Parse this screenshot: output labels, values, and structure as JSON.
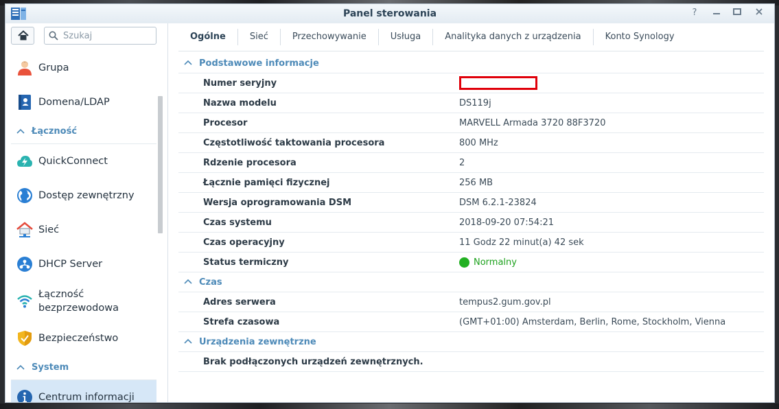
{
  "window": {
    "title": "Panel sterowania"
  },
  "sidebar": {
    "search_placeholder": "Szukaj",
    "items": [
      {
        "label": "Grupa",
        "icon": "group-icon"
      },
      {
        "label": "Domena/LDAP",
        "icon": "domain-ldap-icon"
      }
    ],
    "section_connectivity": "Łączność",
    "connectivity_items": [
      {
        "label": "QuickConnect",
        "icon": "quickconnect-icon"
      },
      {
        "label": "Dostęp zewnętrzny",
        "icon": "globe-icon"
      },
      {
        "label": "Sieć",
        "icon": "network-house-icon"
      },
      {
        "label": "DHCP Server",
        "icon": "dhcp-icon"
      },
      {
        "label": "Łączność bezprzewodowa",
        "icon": "wifi-icon"
      },
      {
        "label": "Bezpieczeństwo",
        "icon": "shield-icon"
      }
    ],
    "section_system": "System",
    "system_items": [
      {
        "label": "Centrum informacji",
        "icon": "info-icon",
        "active": true
      }
    ]
  },
  "tabs": [
    "Ogólne",
    "Sieć",
    "Przechowywanie",
    "Usługa",
    "Analityka danych z urządzenia",
    "Konto Synology"
  ],
  "sections": {
    "basic": {
      "title": "Podstawowe informacje",
      "rows": [
        {
          "key": "Numer seryjny",
          "value": ""
        },
        {
          "key": "Nazwa modelu",
          "value": "DS119j"
        },
        {
          "key": "Procesor",
          "value": "MARVELL Armada 3720 88F3720"
        },
        {
          "key": "Częstotliwość taktowania procesora",
          "value": "800 MHz"
        },
        {
          "key": "Rdzenie procesora",
          "value": "2"
        },
        {
          "key": "Łącznie pamięci fizycznej",
          "value": "256 MB"
        },
        {
          "key": "Wersja oprogramowania DSM",
          "value": "DSM 6.2.1-23824"
        },
        {
          "key": "Czas systemu",
          "value": "2018-09-20 07:54:21"
        },
        {
          "key": "Czas operacyjny",
          "value": "11 Godz 22 minut(a) 42 sek"
        },
        {
          "key": "Status termiczny",
          "value": "Normalny"
        }
      ]
    },
    "time": {
      "title": "Czas",
      "rows": [
        {
          "key": "Adres serwera",
          "value": "tempus2.gum.gov.pl"
        },
        {
          "key": "Strefa czasowa",
          "value": "(GMT+01:00) Amsterdam, Berlin, Rome, Stockholm, Vienna"
        }
      ]
    },
    "external": {
      "title": "Urządzenia zewnętrzne",
      "message": "Brak podłączonych urządzeń zewnętrznych."
    }
  },
  "colors": {
    "accent": "#4d8ab8",
    "active_item_bg": "#d6e7f7",
    "status_ok": "#22b022",
    "redaction": "#e0000a"
  }
}
